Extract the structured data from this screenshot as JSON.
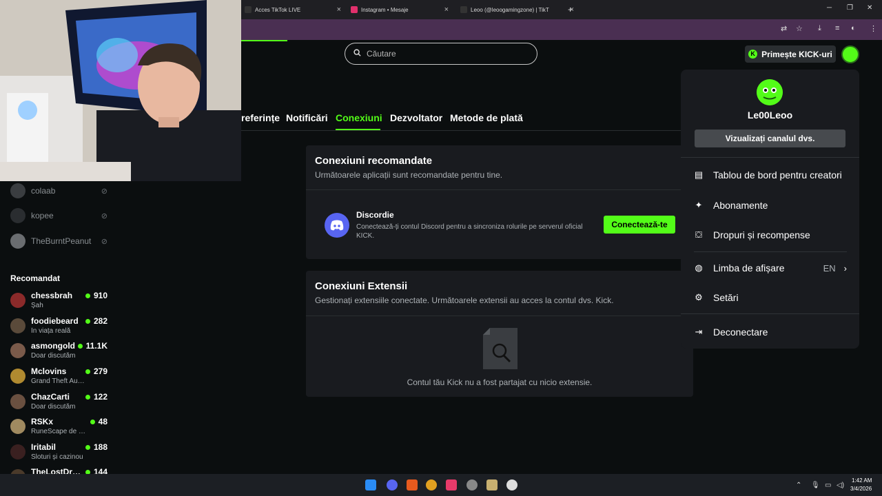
{
  "browser": {
    "tabs": [
      {
        "title": "Acces TikTok LIVE",
        "color": "#1a1a1a"
      },
      {
        "title": "Instagram • Mesaje",
        "color": "#e1306c"
      },
      {
        "title": "Leoo (@leoogamingzone) | TikT",
        "color": "#1a1a1a"
      }
    ],
    "new_tab": "+",
    "minimize": "─",
    "maximize": "❐",
    "close": "✕"
  },
  "search": {
    "placeholder": "Căutare"
  },
  "header": {
    "kick_button": "Primește KICK-uri"
  },
  "settings_tabs": [
    "referințe",
    "Notificări",
    "Conexiuni",
    "Dezvoltator",
    "Metode de plată"
  ],
  "recommended_connections": {
    "title": "Conexiuni recomandate",
    "subtitle": "Următoarele aplicații sunt recomandate pentru tine.",
    "discord": {
      "name": "Discordie",
      "description": "Conectează-ți contul Discord pentru a sincroniza rolurile pe serverul oficial KICK.",
      "button": "Conectează-te"
    }
  },
  "extension_connections": {
    "title": "Conexiuni Extensii",
    "subtitle": "Gestionați extensiile conectate. Următoarele extensii au acces la contul dvs. Kick.",
    "empty_text": "Contul tău Kick nu a fost partajat cu nicio extensie."
  },
  "sidebar": {
    "following": [
      {
        "name": "colaab",
        "color": "#3a3d40"
      },
      {
        "name": "kopee",
        "color": "#2a2d30"
      },
      {
        "name": "TheBurntPeanut",
        "color": "#6a6d70"
      }
    ],
    "recommended_title": "Recomandat",
    "recommended": [
      {
        "name": "chessbrah",
        "category": "Șah",
        "count": "910",
        "color": "#8b2a2a"
      },
      {
        "name": "foodiebeard",
        "category": "În viața reală",
        "count": "282",
        "color": "#5a4a3a"
      },
      {
        "name": "asmongold",
        "category": "Doar discutăm",
        "count": "11.1K",
        "color": "#7a5a4a"
      },
      {
        "name": "Mclovins",
        "category": "Grand Theft Auto V",
        "count": "279",
        "color": "#b08a30"
      },
      {
        "name": "ChazCarti",
        "category": "Doar discutăm",
        "count": "122",
        "color": "#6a5040"
      },
      {
        "name": "RSKx",
        "category": "RuneScape de Modă Veche",
        "count": "48",
        "color": "#a08a60"
      },
      {
        "name": "Iritabil",
        "category": "Sloturi și cazinou",
        "count": "188",
        "color": "#3a2020"
      },
      {
        "name": "TheLostDrone",
        "category": "",
        "count": "144",
        "color": "#4a3a2a"
      }
    ]
  },
  "menu": {
    "username": "Le00Leoo",
    "view_channel": "Vizualizați canalul dvs.",
    "items": [
      {
        "label": "Tablou de bord pentru creatori",
        "icon": "dashboard-icon",
        "glyph": "▤"
      },
      {
        "label": "Abonamente",
        "icon": "sparkle-icon",
        "glyph": "✦"
      },
      {
        "label": "Dropuri și recompense",
        "icon": "gift-icon",
        "glyph": "⛋"
      },
      {
        "label": "Limba de afișare",
        "icon": "globe-icon",
        "glyph": "◍",
        "value": "EN"
      },
      {
        "label": "Setări",
        "icon": "gear-icon",
        "glyph": "⚙"
      },
      {
        "label": "Deconectare",
        "icon": "logout-icon",
        "glyph": "⇥"
      }
    ]
  },
  "clock": {
    "time": "1:42 AM",
    "date": "3/4/2026"
  },
  "colors": {
    "accent": "#53fc18",
    "background": "#0b0e0f",
    "card": "#191b1f"
  }
}
